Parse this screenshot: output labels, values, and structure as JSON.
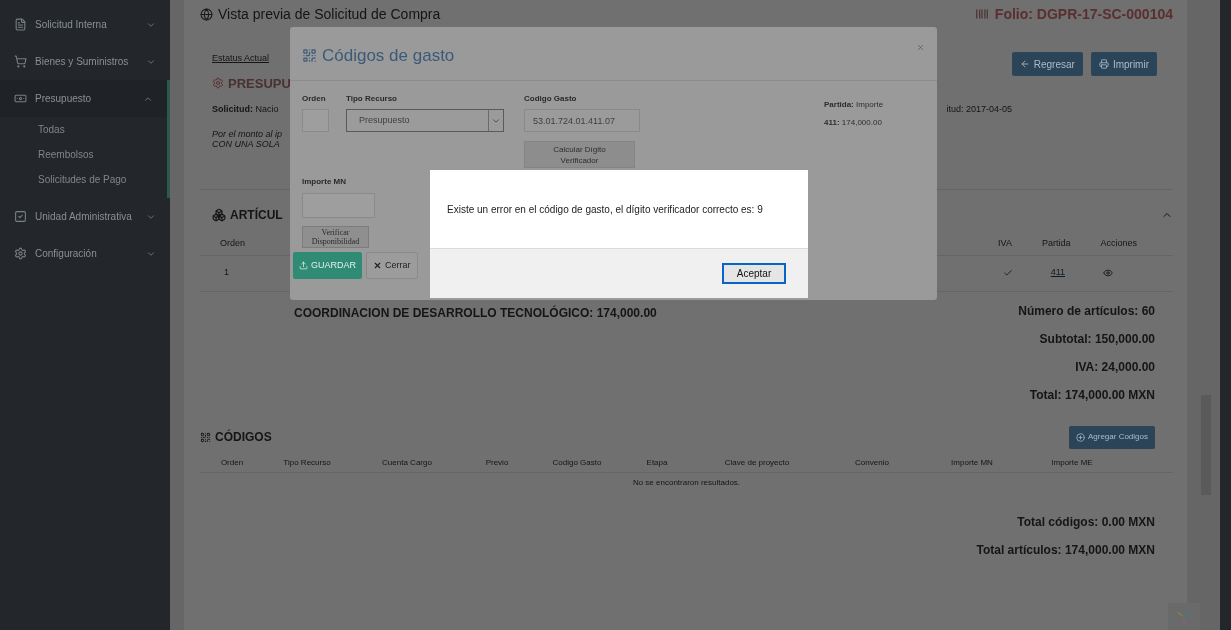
{
  "sidebar": {
    "items": [
      {
        "label": "Solicitud Interna",
        "expanded": false
      },
      {
        "label": "Bienes y Suministros",
        "expanded": false
      },
      {
        "label": "Presupuesto",
        "expanded": true,
        "children": [
          {
            "label": "Todas"
          },
          {
            "label": "Reembolsos"
          },
          {
            "label": "Solicitudes de Pago"
          }
        ]
      },
      {
        "label": "Unidad Administrativa",
        "expanded": false
      },
      {
        "label": "Configuración",
        "expanded": false
      }
    ]
  },
  "page": {
    "title": "Vista previa de Solicitud de Compra",
    "folio": "Folio: DGPR-17-SC-000104",
    "status_label": "Estatus Actual",
    "status": "PRESUPU",
    "solicitud_label": "Solicitud:",
    "solicitud_value": "Nacio",
    "note_lines": [
      "Por el monto al ip",
      "CON UNA SOLA"
    ],
    "date": "itud: 2017-04-05",
    "buttons": [
      {
        "label": "Regresar"
      },
      {
        "label": "Imprimir"
      }
    ]
  },
  "articles": {
    "title": "ARTÍCUL",
    "columns_left": [
      "Orden"
    ],
    "columns_right": [
      "IVA",
      "Partida",
      "Acciones"
    ],
    "row": {
      "orden": "1",
      "iva_checked": true,
      "partida": "411"
    },
    "area_total": "COORDINACION DE DESARROLLO TECNOLÓGICO: 174,000.00",
    "summary": [
      "Número de artículos: 60",
      "Subtotal: 150,000.00",
      "IVA: 24,000.00",
      "Total: 174,000.00 MXN"
    ]
  },
  "codes": {
    "title": "CÓDIGOS",
    "add_button": "Agregar Codigos",
    "columns": [
      "Orden",
      "Tipo Recurso",
      "Cuenta Cargo",
      "Previo",
      "Codigo Gasto",
      "Etapa",
      "Clave de proyecto",
      "Convenio",
      "Importe MN",
      "Importe ME"
    ],
    "empty": "No se encontraron resultados.",
    "totals": [
      "Total códigos: 0.00 MXN",
      "Total artículos: 174,000.00 MXN"
    ]
  },
  "modal": {
    "title": "Códigos de gasto",
    "orden_label": "Orden",
    "tipo_label": "Tipo Recurso",
    "tipo_value": "Presupuesto",
    "codigo_label": "Codigo Gasto",
    "codigo_value": "53.01.724.01.411.07",
    "calc_button": "Calcular Dígito Verificador",
    "partida_label": "Partida:",
    "partida_header": "Importe",
    "partida_key": "411:",
    "partida_value": "174,000.00",
    "importe_label": "Importe MN",
    "verify_button": "Verificar Disponibilidad",
    "save_button": "GUARDAR",
    "close_button": "Cerrar"
  },
  "alert": {
    "message": "Existe un error en el código de gasto, el dígito verificador correcto es: 9",
    "button": "Aceptar"
  }
}
